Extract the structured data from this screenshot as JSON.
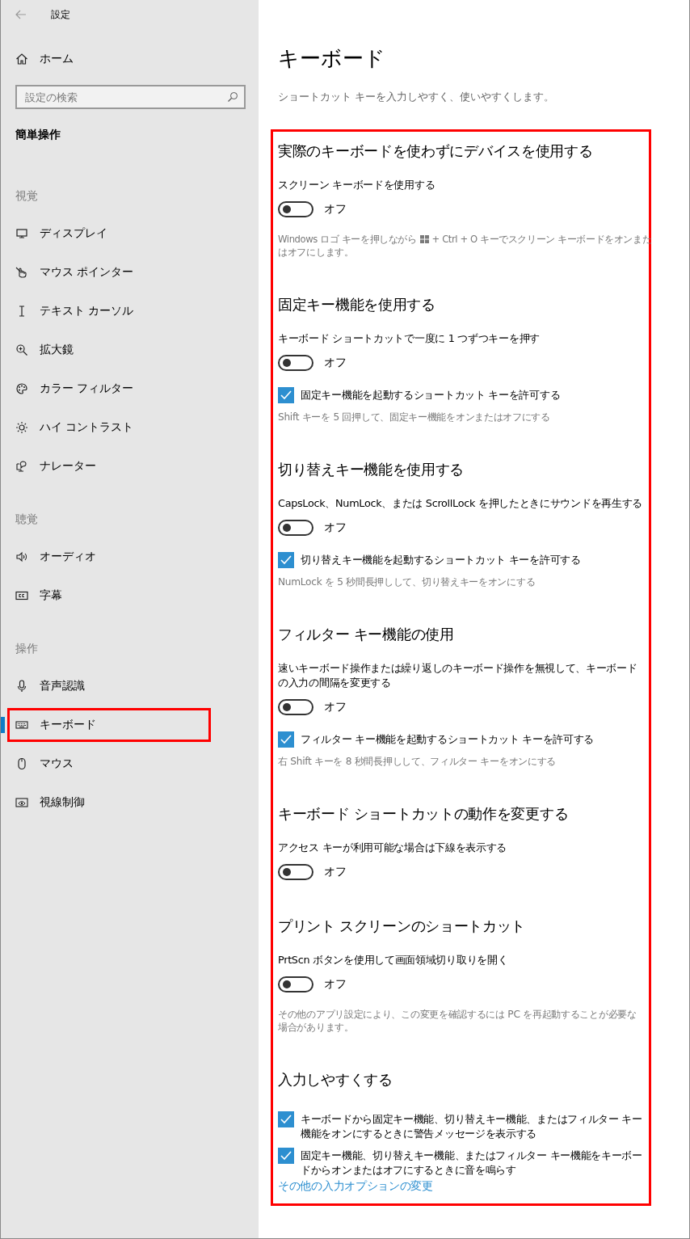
{
  "window": {
    "title": "設定"
  },
  "sidebar": {
    "home": "ホーム",
    "search": {
      "placeholder": "設定の検索"
    },
    "category": "簡単操作",
    "groups": [
      {
        "heading": "視覚",
        "items": [
          {
            "label": "ディスプレイ",
            "kind": "display",
            "selected": false,
            "highlighted": false
          },
          {
            "label": "マウス ポインター",
            "kind": "pointer",
            "selected": false,
            "highlighted": false
          },
          {
            "label": "テキスト カーソル",
            "kind": "cursor",
            "selected": false,
            "highlighted": false
          },
          {
            "label": "拡大鏡",
            "kind": "magnifier",
            "selected": false,
            "highlighted": false
          },
          {
            "label": "カラー フィルター",
            "kind": "palette",
            "selected": false,
            "highlighted": false
          },
          {
            "label": "ハイ コントラスト",
            "kind": "brightness",
            "selected": false,
            "highlighted": false
          },
          {
            "label": "ナレーター",
            "kind": "narrator",
            "selected": false,
            "highlighted": false
          }
        ]
      },
      {
        "heading": "聴覚",
        "items": [
          {
            "label": "オーディオ",
            "kind": "speaker",
            "selected": false,
            "highlighted": false
          },
          {
            "label": "字幕",
            "kind": "captions",
            "selected": false,
            "highlighted": false
          }
        ]
      },
      {
        "heading": "操作",
        "items": [
          {
            "label": "音声認識",
            "kind": "microphone",
            "selected": false,
            "highlighted": false
          },
          {
            "label": "キーボード",
            "kind": "keyboard",
            "selected": true,
            "highlighted": true
          },
          {
            "label": "マウス",
            "kind": "mouse",
            "selected": false,
            "highlighted": false
          },
          {
            "label": "視線制御",
            "kind": "eye",
            "selected": false,
            "highlighted": false
          }
        ]
      }
    ]
  },
  "page": {
    "title": "キーボード",
    "subtitle": "ショートカット キーを入力しやすく、使いやすくします。",
    "highlighted": true,
    "sections": [
      {
        "heading": "実際のキーボードを使わずにデバイスを使用する",
        "items": [
          {
            "kind": "toggle",
            "label": "スクリーン キーボードを使用する",
            "on": false,
            "state_text": "オフ"
          },
          {
            "kind": "key-note",
            "text_before": "Windows ロゴ キーを押しながら",
            "text_after": "+ Ctrl + O キーでスクリーン キーボードをオンまた",
            "text_wrap": "はオフにします。"
          }
        ]
      },
      {
        "heading": "固定キー機能を使用する",
        "items": [
          {
            "kind": "toggle",
            "label": "キーボード ショートカットで一度に 1 つずつキーを押す",
            "on": false,
            "state_text": "オフ"
          },
          {
            "kind": "checkbox",
            "label": "固定キー機能を起動するショートカット キーを許可する",
            "checked": true
          },
          {
            "kind": "note",
            "text": "Shift キーを 5 回押して、固定キー機能をオンまたはオフにする"
          }
        ]
      },
      {
        "heading": "切り替えキー機能を使用する",
        "items": [
          {
            "kind": "toggle",
            "label": "CapsLock、NumLock、または ScrollLock を押したときにサウンドを再生する",
            "on": false,
            "state_text": "オフ"
          },
          {
            "kind": "checkbox",
            "label": "切り替えキー機能を起動するショートカット キーを許可する",
            "checked": true
          },
          {
            "kind": "note",
            "text": "NumLock を 5 秒間長押しして、切り替えキーをオンにする"
          }
        ]
      },
      {
        "heading": "フィルター キー機能の使用",
        "items": [
          {
            "kind": "toggle",
            "label": "速いキーボード操作または繰り返しのキーボード操作を無視して、キーボードの入力の間隔を変更する",
            "on": false,
            "state_text": "オフ"
          },
          {
            "kind": "checkbox",
            "label": "フィルター キー機能を起動するショートカット キーを許可する",
            "checked": true
          },
          {
            "kind": "note",
            "text": "右 Shift キーを 8 秒間長押しして、フィルター キーをオンにする"
          }
        ]
      },
      {
        "heading": "キーボード ショートカットの動作を変更する",
        "items": [
          {
            "kind": "toggle",
            "label": "アクセス キーが利用可能な場合は下線を表示する",
            "on": false,
            "state_text": "オフ"
          }
        ]
      },
      {
        "heading": "プリント スクリーンのショートカット",
        "items": [
          {
            "kind": "toggle",
            "label": "PrtScn ボタンを使用して画面領域切り取りを開く",
            "on": false,
            "state_text": "オフ"
          },
          {
            "kind": "note",
            "text": "その他のアプリ設定により、この変更を確認するには PC を再起動することが必要な場合があります。"
          }
        ]
      },
      {
        "heading": "入力しやすくする",
        "items": [
          {
            "kind": "checkbox",
            "label": "キーボードから固定キー機能、切り替えキー機能、またはフィルター キー機能をオンにするときに警告メッセージを表示する",
            "checked": true
          },
          {
            "kind": "checkbox",
            "label": "固定キー機能、切り替えキー機能、またはフィルター キー機能をキーボードからオンまたはオフにするときに音を鳴らす",
            "checked": true
          },
          {
            "kind": "link",
            "text": "その他の入力オプションの変更"
          }
        ]
      }
    ]
  }
}
